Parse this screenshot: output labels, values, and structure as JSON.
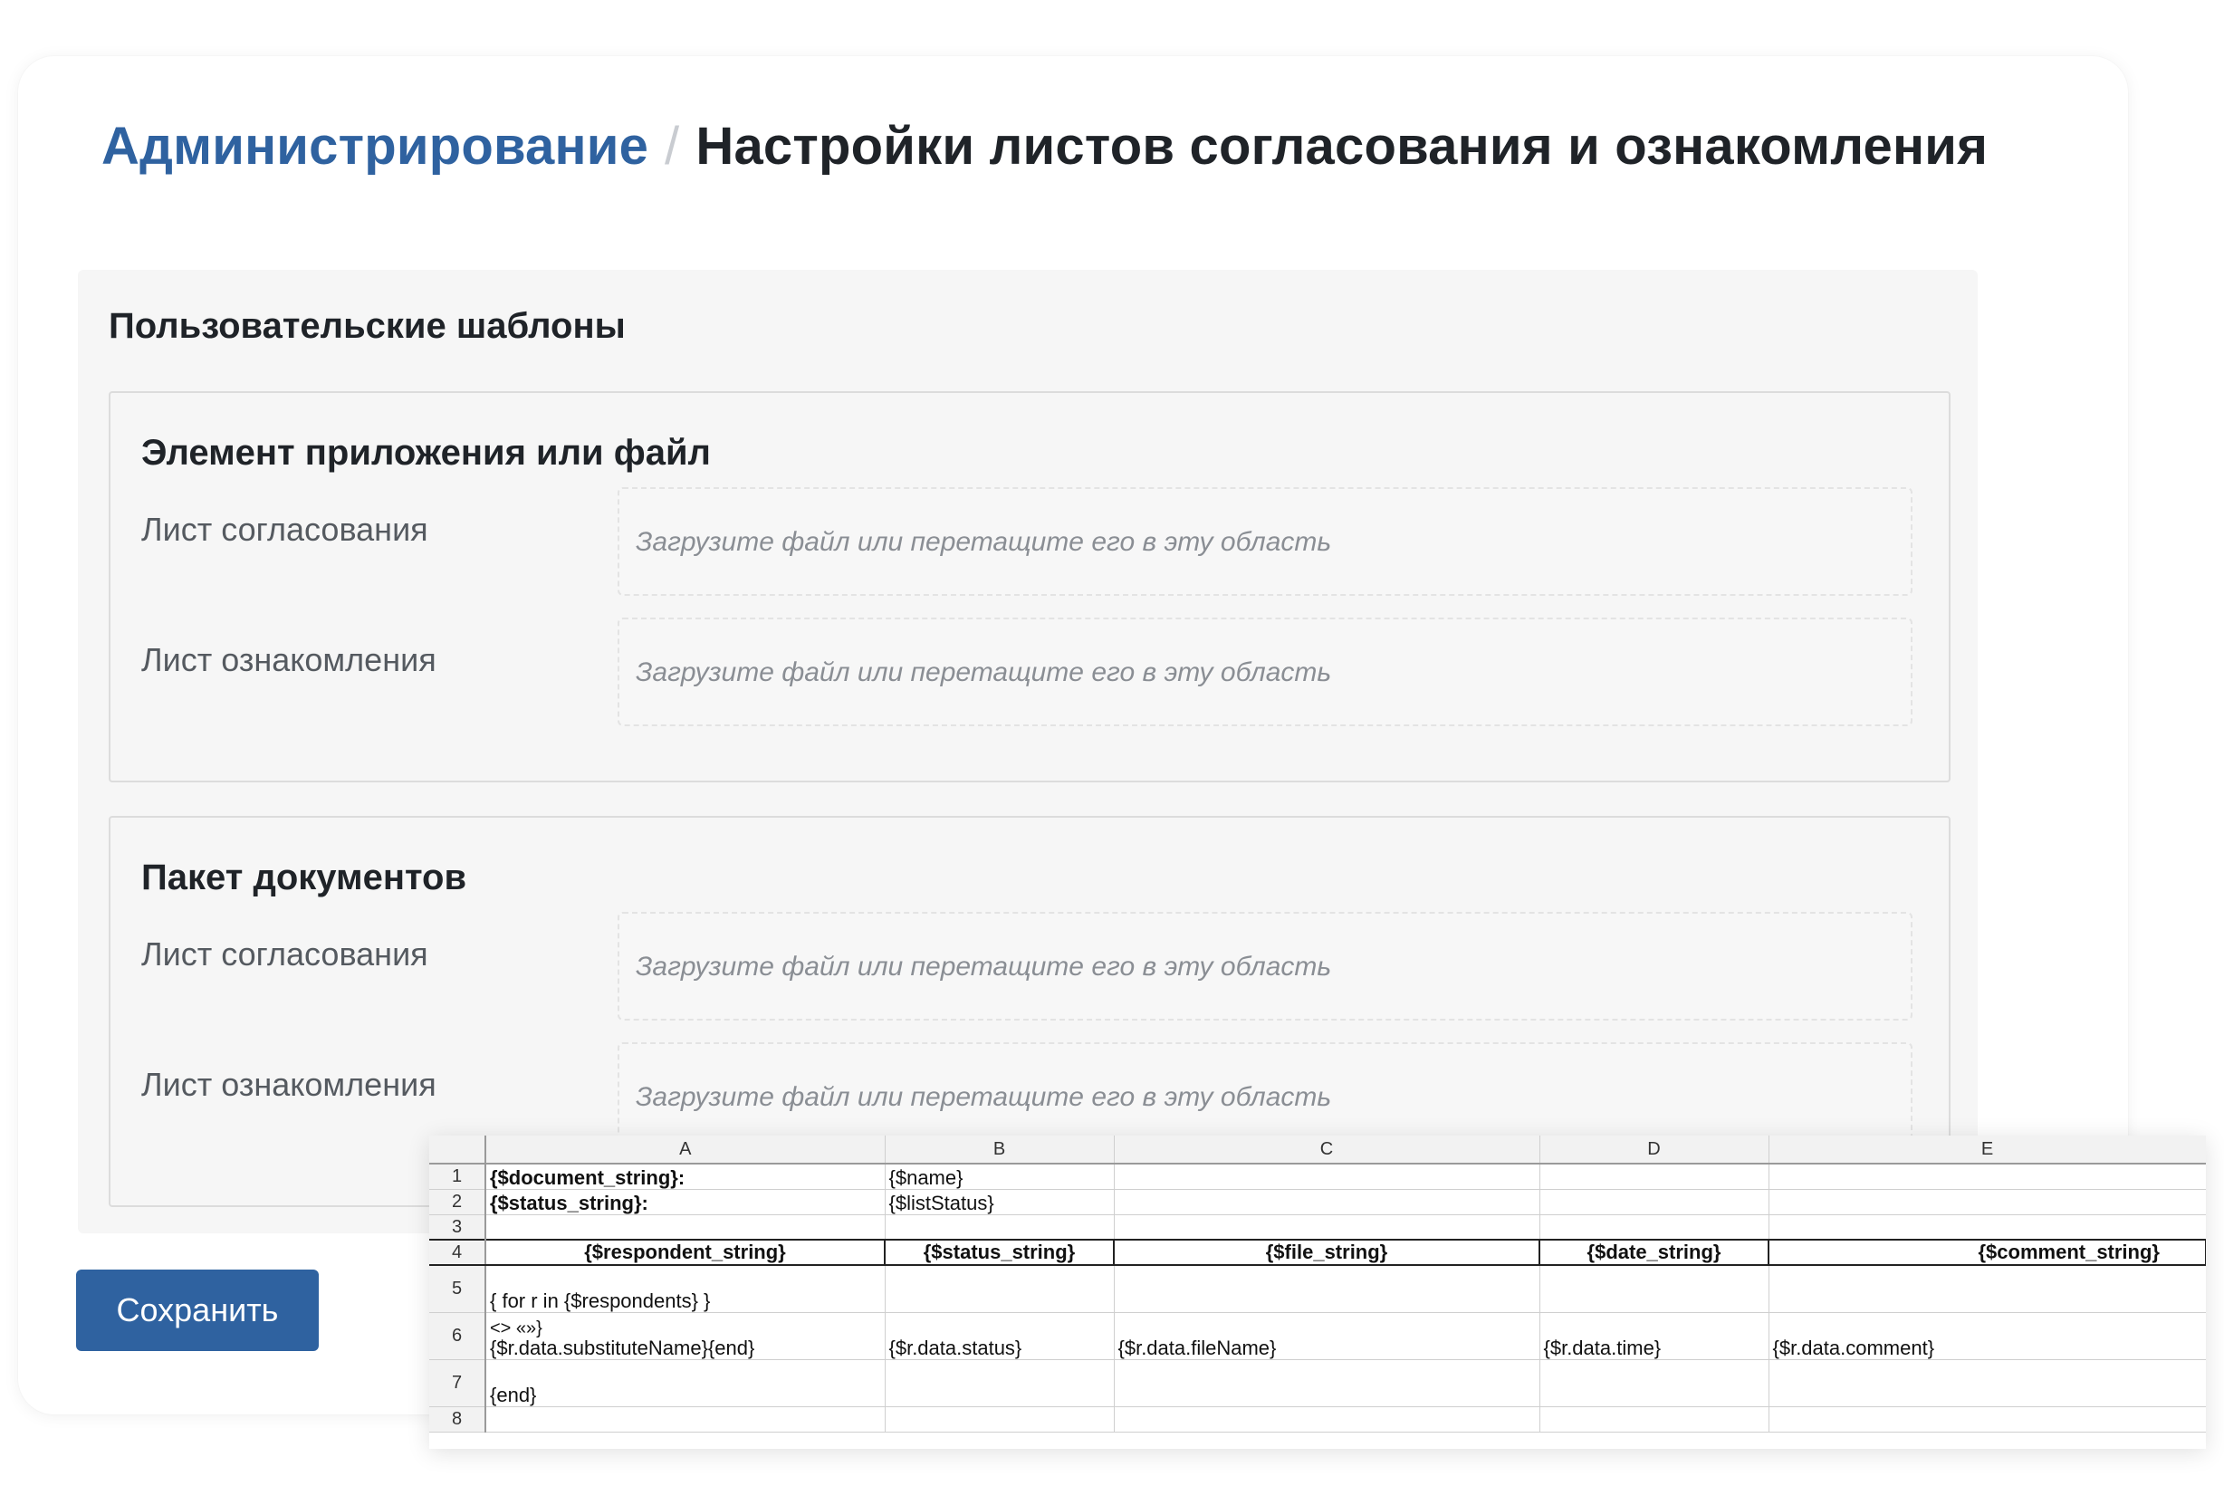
{
  "breadcrumb": {
    "parent": "Администрирование",
    "separator": "/",
    "current": "Настройки листов согласования и ознакомления"
  },
  "section": {
    "title": "Пользовательские шаблоны",
    "groups": [
      {
        "title": "Элемент приложения или файл",
        "rows": [
          {
            "label": "Лист согласования",
            "placeholder": "Загрузите файл или перетащите его в эту область"
          },
          {
            "label": "Лист ознакомления",
            "placeholder": "Загрузите файл или перетащите его в эту область"
          }
        ]
      },
      {
        "title": "Пакет документов",
        "rows": [
          {
            "label": "Лист согласования",
            "placeholder": "Загрузите файл или перетащите его в эту область"
          },
          {
            "label": "Лист ознакомления",
            "placeholder": "Загрузите файл или перетащите его в эту область"
          }
        ]
      }
    ]
  },
  "save_label": "Сохранить",
  "colors": {
    "accent": "#2f62a0",
    "heading": "#1f2328",
    "panel": "#f6f6f6"
  },
  "spreadsheet": {
    "columns": [
      "A",
      "B",
      "C",
      "D",
      "E"
    ],
    "row_numbers": [
      "1",
      "2",
      "3",
      "4",
      "5",
      "6",
      "7",
      "8"
    ],
    "cells": {
      "r1": [
        "{$document_string}:",
        "{$name}",
        "",
        "",
        ""
      ],
      "r2": [
        "{$status_string}:",
        "{$listStatus}",
        "",
        "",
        ""
      ],
      "r3": [
        "",
        "",
        "",
        "",
        ""
      ],
      "r4": [
        "{$respondent_string}",
        "{$status_string}",
        "{$file_string}",
        "{$date_string}",
        "{$comment_string}"
      ],
      "r5": [
        "{ for r in {$respondents} }",
        "",
        "",
        "",
        ""
      ],
      "r6a_line1": "<> «»}",
      "r6a_line2": "{$r.data.substituteName}{end}",
      "r6": [
        "",
        "{$r.data.status}",
        "{$r.data.fileName}",
        "{$r.data.time}",
        "{$r.data.comment}"
      ],
      "r7": [
        "{end}",
        "",
        "",
        "",
        ""
      ],
      "r8": [
        "",
        "",
        "",
        "",
        ""
      ]
    }
  }
}
